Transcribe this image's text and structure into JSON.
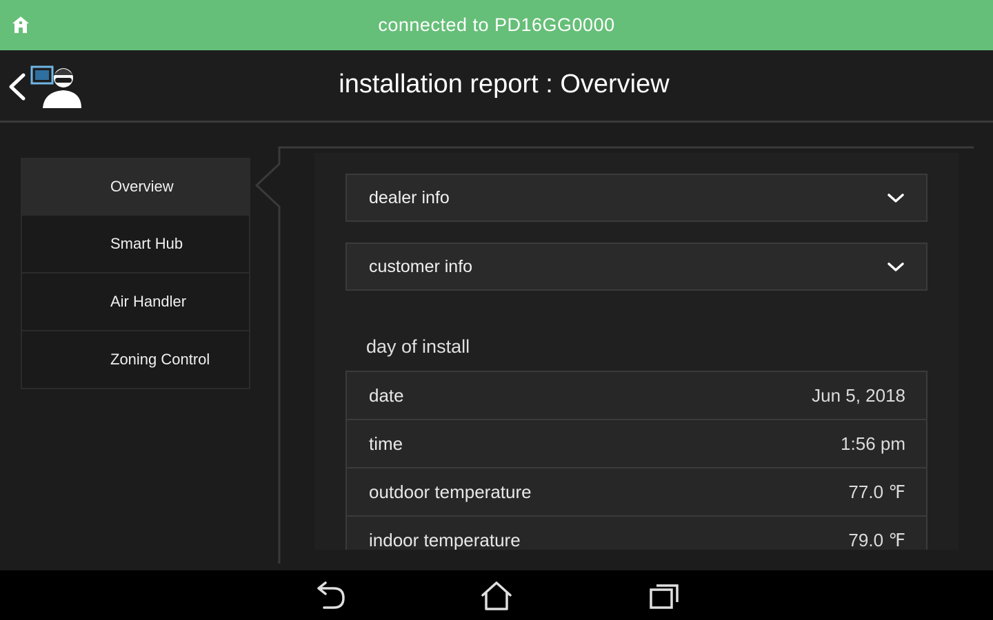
{
  "status_bar": {
    "connection_text": "connected to PD16GG0000",
    "background_color": "#66bf78"
  },
  "header": {
    "title": "installation report : Overview"
  },
  "sidebar": {
    "items": [
      {
        "label": "Overview",
        "active": true
      },
      {
        "label": "Smart Hub",
        "active": false
      },
      {
        "label": "Air Handler",
        "active": false
      },
      {
        "label": "Zoning Control",
        "active": false
      }
    ]
  },
  "accordions": {
    "dealer_info": {
      "label": "dealer info",
      "icon": "chevron-down-icon"
    },
    "customer_info": {
      "label": "customer info",
      "icon": "chevron-down-icon"
    }
  },
  "install_section": {
    "title": "day of install",
    "rows": [
      {
        "label": "date",
        "value": "Jun 5, 2018"
      },
      {
        "label": "time",
        "value": "1:56 pm"
      },
      {
        "label": "outdoor temperature",
        "value": "77.0 ℉"
      },
      {
        "label": "indoor temperature",
        "value": "79.0 ℉"
      }
    ]
  },
  "nav_bar": {
    "icons": [
      "back-arrow-icon",
      "home-outline-icon",
      "recent-apps-icon"
    ]
  }
}
